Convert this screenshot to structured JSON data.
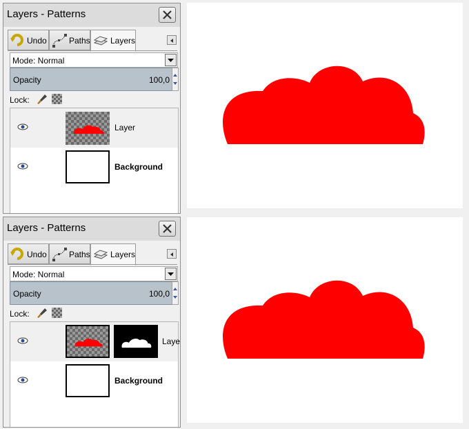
{
  "panels": [
    {
      "title": "Layers - Patterns",
      "tabs": [
        "Undo",
        "Paths",
        "Layers"
      ],
      "mode_label": "Mode: Normal",
      "opacity_label": "Opacity",
      "opacity_value": "100,0",
      "lock_label": "Lock:",
      "layers": [
        {
          "name": "Layer",
          "selected": true,
          "has_mask": false
        },
        {
          "name": "Background",
          "selected": false,
          "has_mask": false
        }
      ]
    },
    {
      "title": "Layers - Patterns",
      "tabs": [
        "Undo",
        "Paths",
        "Layers"
      ],
      "mode_label": "Mode: Normal",
      "opacity_label": "Opacity",
      "opacity_value": "100,0",
      "lock_label": "Lock:",
      "layers": [
        {
          "name": "Laye",
          "selected": true,
          "has_mask": true
        },
        {
          "name": "Background",
          "selected": false,
          "has_mask": false
        }
      ]
    }
  ],
  "colors": {
    "cloud": "#ff0000",
    "selection_fill": "#b7c2cb"
  },
  "icons": [
    "undo-icon",
    "paths-icon",
    "layers-icon",
    "close-icon",
    "eye-icon",
    "brush-icon",
    "checker-icon"
  ]
}
